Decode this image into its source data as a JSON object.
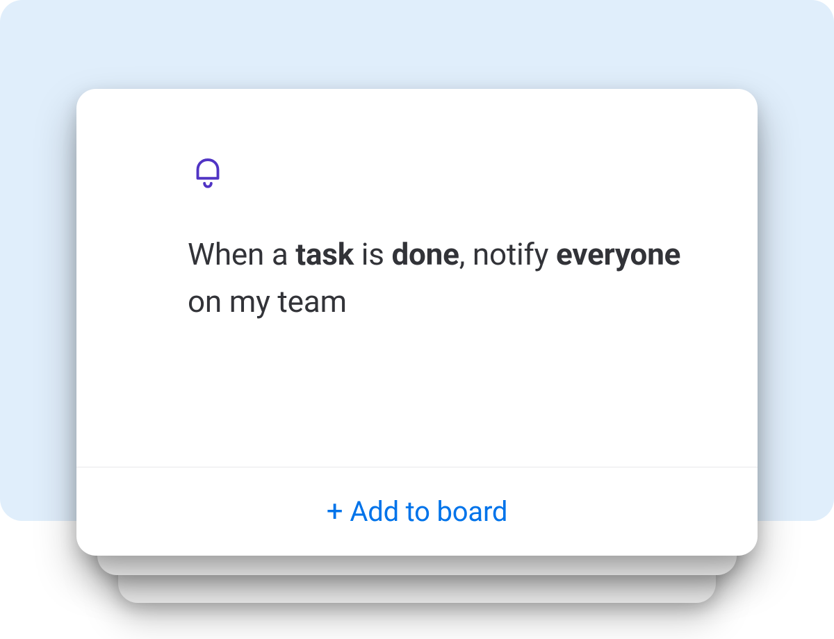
{
  "card": {
    "icon": "bell-icon",
    "rule": {
      "seg1": "When a ",
      "bold1": "task",
      "seg2": " is ",
      "bold2": "done",
      "seg3": ", notify ",
      "bold3": "everyone",
      "seg4": " on my team"
    },
    "action_label": "Add to board",
    "action_prefix": "+"
  },
  "colors": {
    "backdrop": "#e0eefb",
    "icon": "#5034c4",
    "text": "#323338",
    "link": "#0073ea",
    "divider": "#e8e9eb"
  }
}
